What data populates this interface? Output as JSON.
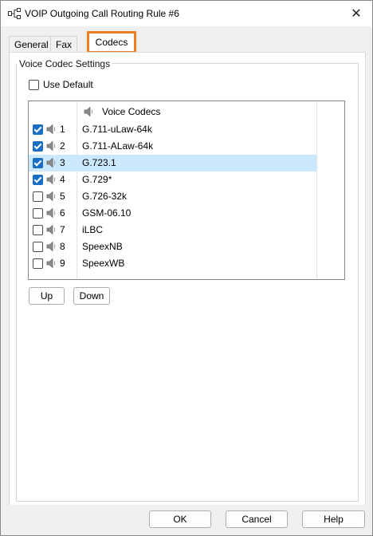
{
  "window": {
    "title": "VOIP Outgoing Call Routing Rule #6",
    "close_glyph": "✕"
  },
  "tabs": [
    {
      "label": "General",
      "active": false
    },
    {
      "label": "Fax",
      "active": false
    },
    {
      "label": "Codecs",
      "active": true,
      "highlight_color": "#ef7d22"
    }
  ],
  "group": {
    "legend": "Voice Codec Settings",
    "use_default": {
      "label": "Use Default",
      "checked": false
    },
    "list": {
      "header": "Voice Codecs",
      "rows": [
        {
          "num": "1",
          "codec": "G.711-uLaw-64k",
          "checked": true,
          "selected": false
        },
        {
          "num": "2",
          "codec": "G.711-ALaw-64k",
          "checked": true,
          "selected": false
        },
        {
          "num": "3",
          "codec": "G.723.1",
          "checked": true,
          "selected": true
        },
        {
          "num": "4",
          "codec": "G.729*",
          "checked": true,
          "selected": false
        },
        {
          "num": "5",
          "codec": "G.726-32k",
          "checked": false,
          "selected": false
        },
        {
          "num": "6",
          "codec": "GSM-06.10",
          "checked": false,
          "selected": false
        },
        {
          "num": "7",
          "codec": "iLBC",
          "checked": false,
          "selected": false
        },
        {
          "num": "8",
          "codec": "SpeexNB",
          "checked": false,
          "selected": false
        },
        {
          "num": "9",
          "codec": "SpeexWB",
          "checked": false,
          "selected": false
        }
      ]
    },
    "up_label": "Up",
    "down_label": "Down"
  },
  "footer": {
    "ok_label": "OK",
    "cancel_label": "Cancel",
    "help_label": "Help"
  },
  "colors": {
    "check_blue": "#1a6fc4",
    "selection": "#cce8ff"
  }
}
